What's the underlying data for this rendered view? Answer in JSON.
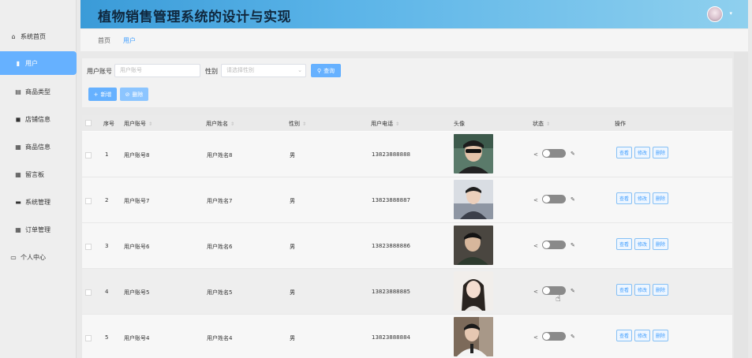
{
  "app": {
    "title": "植物销售管理系统的设计与实现"
  },
  "sidebar": {
    "items": [
      {
        "icon": "⌂",
        "icon_name": "home-icon",
        "label": "系统首页"
      },
      {
        "icon": "▮",
        "icon_name": "bar-chart-icon",
        "label": "用户"
      },
      {
        "icon": "▤",
        "icon_name": "document-icon",
        "label": "商品类型"
      },
      {
        "icon": "◼",
        "icon_name": "shop-icon",
        "label": "店铺信息"
      },
      {
        "icon": "▦",
        "icon_name": "grid-icon",
        "label": "商品信息"
      },
      {
        "icon": "▦",
        "icon_name": "grid-icon",
        "label": "留言板"
      },
      {
        "icon": "▬",
        "icon_name": "monitor-icon",
        "label": "系统管理"
      },
      {
        "icon": "▦",
        "icon_name": "grid-icon",
        "label": "订单管理"
      },
      {
        "icon": "▭",
        "icon_name": "personal-icon",
        "label": "个人中心"
      }
    ]
  },
  "breadcrumb": {
    "home": "首页",
    "current": "用户"
  },
  "search": {
    "account_label": "用户账号",
    "account_placeholder": "用户账号",
    "gender_label": "性别",
    "gender_placeholder": "请选择性别",
    "query_button": "查询",
    "add_button": "新增",
    "delete_button": "删除"
  },
  "table": {
    "headers": {
      "index": "序号",
      "account": "用户账号",
      "name": "用户姓名",
      "gender": "性别",
      "phone": "用户电话",
      "avatar": "头像",
      "status": "状态",
      "action": "操作"
    },
    "action_labels": {
      "view": "查看",
      "edit": "修改",
      "delete": "删除"
    },
    "rows": [
      {
        "index": "1",
        "account": "用户账号8",
        "name": "用户姓名8",
        "gender": "男",
        "phone": "13823888888"
      },
      {
        "index": "2",
        "account": "用户账号7",
        "name": "用户姓名7",
        "gender": "男",
        "phone": "13823888887"
      },
      {
        "index": "3",
        "account": "用户账号6",
        "name": "用户姓名6",
        "gender": "男",
        "phone": "13823888886"
      },
      {
        "index": "4",
        "account": "用户账号5",
        "name": "用户姓名5",
        "gender": "男",
        "phone": "13823888885"
      },
      {
        "index": "5",
        "account": "用户账号4",
        "name": "用户姓名4",
        "gender": "男",
        "phone": "13823888884"
      }
    ]
  },
  "colors": {
    "accent": "#409eff",
    "active_menu": "#66b1ff",
    "header_gradient_start": "#3a9bd8",
    "header_gradient_end": "#8fd0ee"
  }
}
